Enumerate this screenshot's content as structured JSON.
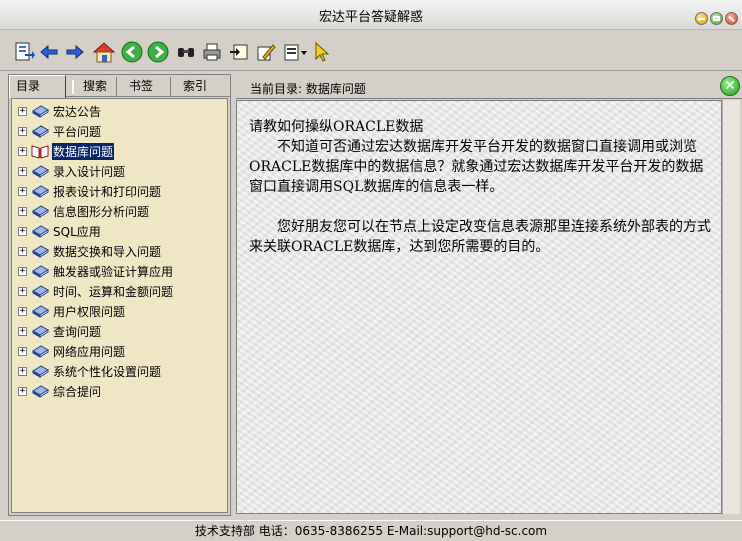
{
  "window": {
    "title": "宏达平台答疑解惑"
  },
  "toolbar": {
    "icons": [
      "exit-icon",
      "back-icon",
      "forward-icon",
      "home-icon",
      "prev-icon",
      "next-icon",
      "find-icon",
      "print-icon",
      "goto-icon",
      "edit-icon",
      "options-icon",
      "pointer-icon"
    ]
  },
  "tabs": [
    {
      "label": "目录",
      "active": true
    },
    {
      "label": "搜索",
      "active": false
    },
    {
      "label": "书签",
      "active": false
    },
    {
      "label": "索引",
      "active": false
    }
  ],
  "tree": {
    "items": [
      {
        "label": "宏达公告",
        "selected": false
      },
      {
        "label": "平台问题",
        "selected": false
      },
      {
        "label": "数据库问题",
        "selected": true
      },
      {
        "label": "录入设计问题",
        "selected": false
      },
      {
        "label": "报表设计和打印问题",
        "selected": false
      },
      {
        "label": "信息图形分析问题",
        "selected": false
      },
      {
        "label": "SQL应用",
        "selected": false
      },
      {
        "label": "数据交换和导入问题",
        "selected": false
      },
      {
        "label": "触发器或验证计算应用",
        "selected": false
      },
      {
        "label": "时间、运算和金额问题",
        "selected": false
      },
      {
        "label": "用户权限问题",
        "selected": false
      },
      {
        "label": "查询问题",
        "selected": false
      },
      {
        "label": "网络应用问题",
        "selected": false
      },
      {
        "label": "系统个性化设置问题",
        "selected": false
      },
      {
        "label": "综合提问",
        "selected": false
      }
    ],
    "expander": "+"
  },
  "right": {
    "current_dir": "当前目录: 数据库问题",
    "close_symbol": "✕"
  },
  "content": {
    "question": "请教如何操纵ORACLE数据",
    "para1": "不知道可否通过宏达数据库开发平台开发的数据窗口直接调用或浏览ORACLE数据库中的数据信息？就象通过宏达数据库开发平台开发的数据窗口直接调用SQL数据库的信息表一样。",
    "para2": "您好朋友您可以在节点上设定改变信息表源那里连接系统外部表的方式来关联ORACLE数据库，达到您所需要的目的。"
  },
  "status": {
    "text": "技术支持部   电话：0635-8386255   E-Mail:support@hd-sc.com"
  },
  "colors": {
    "tree_bg": "#efe6c4",
    "selection": "#0a246a",
    "chrome": "#d4d0c8"
  }
}
